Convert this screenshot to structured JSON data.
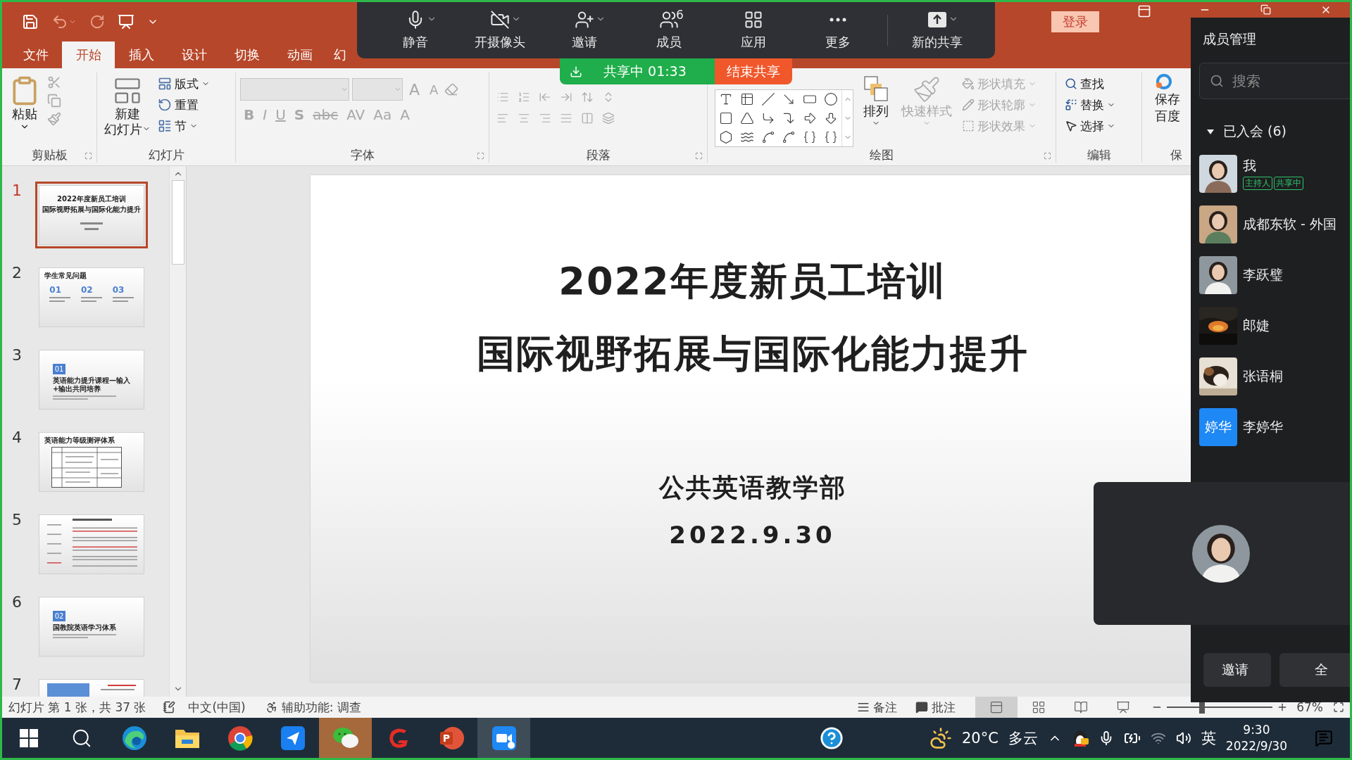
{
  "title_bar": {
    "login_button": "登录"
  },
  "ribbon_tabs": [
    {
      "label": "文件",
      "selected": false
    },
    {
      "label": "开始",
      "selected": true
    },
    {
      "label": "插入",
      "selected": false
    },
    {
      "label": "设计",
      "selected": false
    },
    {
      "label": "切换",
      "selected": false
    },
    {
      "label": "动画",
      "selected": false
    },
    {
      "label": "幻",
      "selected": false
    }
  ],
  "ribbon": {
    "clipboard": {
      "label": "剪贴板",
      "paste": "粘贴"
    },
    "slides": {
      "label": "幻灯片",
      "new_slide": [
        "新建",
        "幻灯片"
      ],
      "items": [
        "版式",
        "重置",
        "节"
      ]
    },
    "font": {
      "label": "字体",
      "disabled": true,
      "size_buttons": [
        "A",
        "A"
      ],
      "buttons": [
        "B",
        "I",
        "U",
        "S",
        "abc",
        "AV",
        "Aa",
        "A"
      ]
    },
    "paragraph": {
      "label": "段落",
      "disabled": true
    },
    "drawing": {
      "label": "绘图",
      "arrange": "排列",
      "quick_styles": {
        "label": "快速样式",
        "disabled": true
      },
      "shape_options": [
        {
          "label": "形状填充",
          "disabled": true
        },
        {
          "label": "形状轮廓",
          "disabled": true
        },
        {
          "label": "形状效果",
          "disabled": true
        }
      ]
    },
    "editing": {
      "label": "编辑",
      "items": [
        "查找",
        "替换",
        "选择"
      ]
    },
    "save_cloud": {
      "lines": [
        "保存",
        "百度"
      ],
      "label": "保"
    }
  },
  "meeting_toolbar": {
    "items": [
      {
        "kind": "mic",
        "label": "静音",
        "caret": true
      },
      {
        "kind": "camera_off",
        "label": "开摄像头",
        "caret": true
      },
      {
        "kind": "invite",
        "label": "邀请",
        "caret": true
      },
      {
        "kind": "members",
        "label": "成员",
        "count": "6"
      },
      {
        "kind": "apps",
        "label": "应用"
      },
      {
        "kind": "more",
        "label": "更多"
      },
      {
        "kind": "share",
        "label": "新的共享",
        "caret": true
      }
    ]
  },
  "share_bar": {
    "status": "共享中 01:33",
    "stop": "结束共享"
  },
  "thumbnails": [
    {
      "number": "1",
      "selected": true,
      "kind": "title",
      "lines": [
        "2022年度新员工培训",
        "国际视野拓展与国际化能力提升"
      ]
    },
    {
      "number": "2",
      "selected": false,
      "kind": "columns",
      "heading": "学生常见问题",
      "columns": [
        "01",
        "02",
        "03"
      ]
    },
    {
      "number": "3",
      "selected": false,
      "kind": "section",
      "badge": "01",
      "heading": "英语能力提升课程—输入+输出共同培养"
    },
    {
      "number": "4",
      "selected": false,
      "kind": "table",
      "heading": "英语能力等级测评体系"
    },
    {
      "number": "5",
      "selected": false,
      "kind": "dense"
    },
    {
      "number": "6",
      "selected": false,
      "kind": "section",
      "badge": "02",
      "heading": "国教院英语学习体系"
    },
    {
      "number": "7",
      "selected": false,
      "kind": "banner"
    }
  ],
  "slide": {
    "title": "2022年度新员工培训",
    "subtitle": "国际视野拓展与国际化能力提升",
    "department": "公共英语教学部",
    "date": "2022.9.30"
  },
  "status_bar": {
    "slide_info": "幻灯片 第 1 张，共 37 张",
    "language": "中文(中国)",
    "accessibility": "辅助功能: 调查",
    "notes": "备注",
    "comments": "批注",
    "views": [
      {
        "kind": "normal",
        "selected": true
      },
      {
        "kind": "sorter",
        "selected": false
      },
      {
        "kind": "reading",
        "selected": false
      },
      {
        "kind": "slideshow",
        "selected": false
      }
    ],
    "zoom": {
      "level": 0.33,
      "value": "67%"
    }
  },
  "member_panel": {
    "title": "成员管理",
    "search": {
      "placeholder": "搜索"
    },
    "section": {
      "label": "已入会 (6)",
      "expanded": true
    },
    "members": [
      {
        "name": "我",
        "tags": [
          "主持人",
          "共享中"
        ]
      },
      {
        "name": "成都东软 - 外国"
      },
      {
        "name": "李跃璧"
      },
      {
        "name": "郎婕"
      },
      {
        "name": "张语桐"
      },
      {
        "name": "李婷华",
        "kind": "initials",
        "initials": "婷华"
      }
    ],
    "video_tile": {
      "kind": "picture"
    },
    "buttons": [
      "邀请",
      "全"
    ]
  },
  "taskbar": {
    "apps": [
      {
        "kind": "start"
      },
      {
        "kind": "search"
      },
      {
        "kind": "swirl"
      },
      {
        "kind": "folder"
      },
      {
        "kind": "ring"
      },
      {
        "kind": "plane"
      },
      {
        "kind": "chat",
        "flashing": true
      },
      {
        "kind": "hook"
      },
      {
        "kind": "slides",
        "letter": "P"
      },
      {
        "kind": "camera",
        "active": true
      }
    ],
    "weather": {
      "temperature": "20°C",
      "condition": "多云"
    },
    "input_method": "英",
    "time": "9:30",
    "date": "2022/9/30"
  }
}
